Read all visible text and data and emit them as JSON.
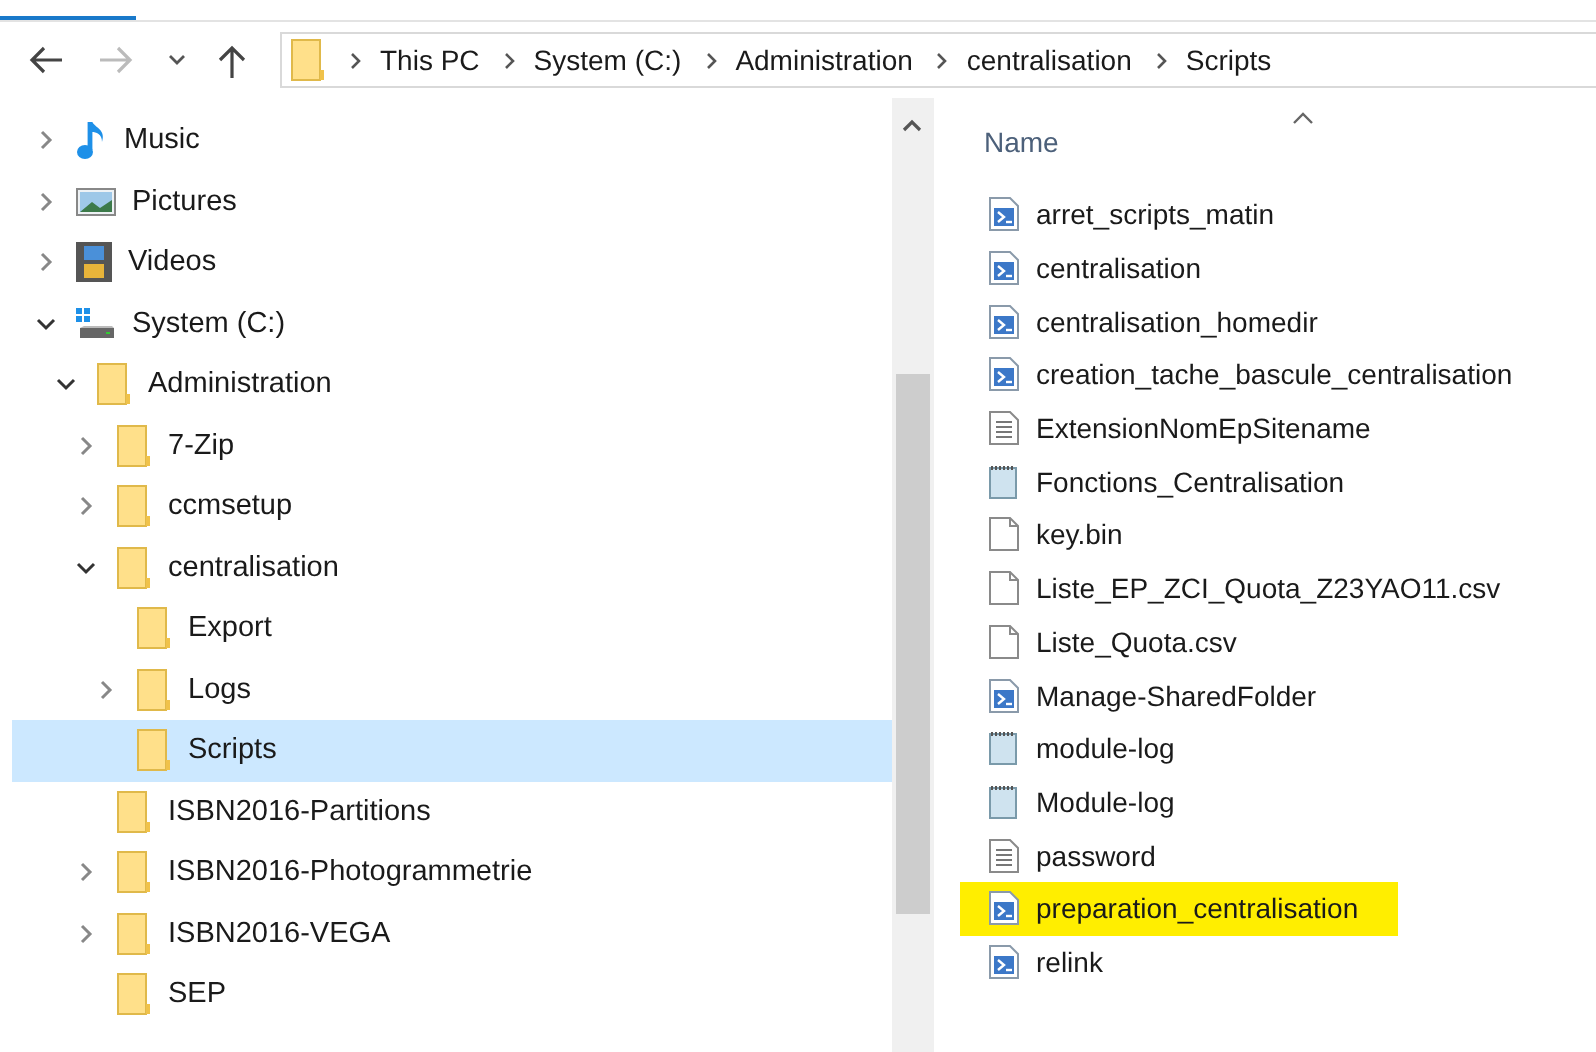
{
  "navigation": {
    "back_enabled": true,
    "forward_enabled": false
  },
  "address_bar": {
    "breadcrumbs": [
      "This PC",
      "System (C:)",
      "Administration",
      "centralisation",
      "Scripts"
    ]
  },
  "tree": [
    {
      "label": "Music",
      "kind": "music",
      "expanded": false,
      "selected": false
    },
    {
      "label": "Pictures",
      "kind": "pictures",
      "expanded": false,
      "selected": false
    },
    {
      "label": "Videos",
      "kind": "videos",
      "expanded": false,
      "selected": false
    },
    {
      "label": "System (C:)",
      "kind": "drive",
      "expanded": true,
      "selected": false,
      "children": [
        {
          "label": "Administration",
          "kind": "folder",
          "expanded": true,
          "selected": false,
          "children": [
            {
              "label": "7-Zip",
              "kind": "folder",
              "expanded": false,
              "selected": false
            },
            {
              "label": "ccmsetup",
              "kind": "folder",
              "expanded": false,
              "selected": false
            },
            {
              "label": "centralisation",
              "kind": "folder",
              "expanded": true,
              "selected": false,
              "children": [
                {
                  "label": "Export",
                  "kind": "folder",
                  "selected": false
                },
                {
                  "label": "Logs",
                  "kind": "folder",
                  "expanded": false,
                  "selected": false
                },
                {
                  "label": "Scripts",
                  "kind": "folder",
                  "selected": true
                }
              ]
            },
            {
              "label": "ISBN2016-Partitions",
              "kind": "folder",
              "selected": false
            },
            {
              "label": "ISBN2016-Photogrammetrie",
              "kind": "folder",
              "expanded": false,
              "selected": false
            },
            {
              "label": "ISBN2016-VEGA",
              "kind": "folder",
              "expanded": false,
              "selected": false
            },
            {
              "label": "SEP",
              "kind": "folder",
              "selected": false
            }
          ]
        }
      ]
    }
  ],
  "file_list": {
    "column_header": "Name",
    "files": [
      {
        "name": "arret_scripts_matin",
        "kind": "script",
        "highlighted": false
      },
      {
        "name": "centralisation",
        "kind": "script",
        "highlighted": false
      },
      {
        "name": "centralisation_homedir",
        "kind": "script",
        "highlighted": false
      },
      {
        "name": "creation_tache_bascule_centralisation",
        "kind": "script",
        "highlighted": false
      },
      {
        "name": "ExtensionNomEpSitename",
        "kind": "text",
        "highlighted": false
      },
      {
        "name": "Fonctions_Centralisation",
        "kind": "notepad",
        "highlighted": false
      },
      {
        "name": "key.bin",
        "kind": "blank",
        "highlighted": false
      },
      {
        "name": "Liste_EP_ZCI_Quota_Z23YAO11.csv",
        "kind": "blank",
        "highlighted": false
      },
      {
        "name": "Liste_Quota.csv",
        "kind": "blank",
        "highlighted": false
      },
      {
        "name": "Manage-SharedFolder",
        "kind": "script",
        "highlighted": false
      },
      {
        "name": "module-log",
        "kind": "notepad",
        "highlighted": false
      },
      {
        "name": "Module-log",
        "kind": "notepad",
        "highlighted": false
      },
      {
        "name": "password",
        "kind": "text",
        "highlighted": false
      },
      {
        "name": "preparation_centralisation",
        "kind": "script",
        "highlighted": true
      },
      {
        "name": "relink",
        "kind": "script",
        "highlighted": false
      }
    ]
  }
}
